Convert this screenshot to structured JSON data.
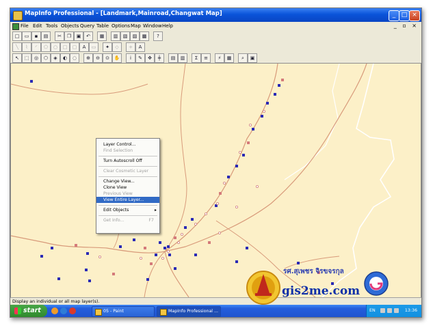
{
  "window": {
    "title": "MapInfo Professional - [Landmark,Mainroad,Changwat Map]",
    "controls": {
      "minimize": "_",
      "maximize": "□",
      "close": "×"
    }
  },
  "menubar": {
    "items": [
      "File",
      "Edit",
      "Tools",
      "Objects",
      "Query",
      "Table",
      "Options",
      "Map",
      "Window",
      "Help"
    ],
    "mdi_controls": "_ ▫ ×"
  },
  "toolbars": {
    "row1": [
      "new",
      "open",
      "save",
      "print",
      "cut",
      "copy",
      "paste",
      "undo",
      "browse",
      "map",
      "graph",
      "layout",
      "redistrict",
      "help"
    ],
    "row2": [
      "line",
      "polyline",
      "arc",
      "polygon",
      "ellipse",
      "rectangle",
      "rounded-rect",
      "text",
      "frame",
      "symbol",
      "reshape",
      "add-node",
      "style"
    ],
    "row3": [
      "select",
      "marquee",
      "radius",
      "polygon-select",
      "boundary",
      "invert",
      "unselect",
      "zoom-in",
      "zoom-out",
      "change-view",
      "grabber",
      "info",
      "label",
      "drag-window",
      "ruler",
      "legend",
      "statistics",
      "sigma",
      "layer-control",
      "hotlink",
      "map-tools",
      "find",
      "image"
    ]
  },
  "context_menu": {
    "items": [
      {
        "label": "Layer Control...",
        "enabled": true
      },
      {
        "label": "Find Selection",
        "enabled": false
      },
      {
        "label": "Turn Autoscroll Off",
        "enabled": true
      },
      {
        "label": "Clear Cosmetic Layer",
        "enabled": false
      },
      {
        "label": "Change View...",
        "enabled": true
      },
      {
        "label": "Clone View",
        "enabled": true
      },
      {
        "label": "Previous View",
        "enabled": false
      },
      {
        "label": "View Entire Layer...",
        "enabled": true,
        "highlighted": true
      },
      {
        "label": "Edit Objects",
        "enabled": true,
        "submenu": "▸"
      },
      {
        "label": "Get Info...",
        "enabled": false,
        "shortcut": "F7"
      }
    ]
  },
  "statusbar": {
    "text": "Display an individual or all map layer(s)."
  },
  "taskbar": {
    "start_label": "start",
    "tasks": [
      {
        "label": "05 - Paint",
        "active": false
      },
      {
        "label": "MapInfo Professional ...",
        "active": true
      }
    ],
    "tray": {
      "language": "EN",
      "clock": "13:36"
    }
  },
  "watermark": {
    "thai_name": "รศ.สุเพชร จิรขจรกุล",
    "site": "gis2me.com",
    "seal_text": "THAMMASAT UNIVERSITY"
  },
  "map_colors": {
    "background": "#fcf0c8",
    "roads": "#d89a7a",
    "boundary": "#ffffff",
    "landmark": "#2a2ab5"
  }
}
